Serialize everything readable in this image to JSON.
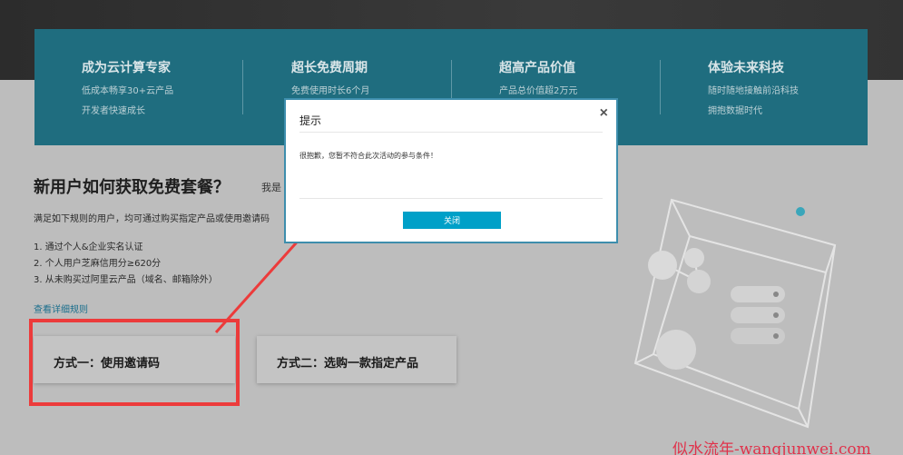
{
  "banner": {
    "features": [
      {
        "title": "成为云计算专家",
        "lines": [
          "低成本畅享30+云产品",
          "开发者快速成长"
        ]
      },
      {
        "title": "超长免费周期",
        "lines": [
          "免费使用时长6个月",
          ""
        ]
      },
      {
        "title": "超高产品价值",
        "lines": [
          "产品总价值超2万元",
          ""
        ]
      },
      {
        "title": "体验未来科技",
        "lines": [
          "随时随地接触前沿科技",
          "拥抱数据时代"
        ]
      }
    ]
  },
  "main": {
    "heading": "新用户如何获取免费套餐？",
    "side_note": "我是",
    "intro": "满足如下规则的用户，均可通过购买指定产品或使用邀请码",
    "rules": [
      "1. 通过个人&企业实名认证",
      "2. 个人用户芝麻信用分≥620分",
      "3. 从未购买过阿里云产品（域名、邮箱除外）"
    ],
    "detail_link": "查看详细规则",
    "methods": [
      "方式一：使用邀请码",
      "方式二：选购一款指定产品"
    ]
  },
  "modal": {
    "title": "提示",
    "close_glyph": "×",
    "message": "很抱歉，您暂不符合此次活动的参与条件！",
    "button_label": "关闭"
  },
  "watermark": "似水流年-wangjunwei.com",
  "colors": {
    "banner_bg": "#1f6d7f",
    "modal_button": "#00a0c8",
    "annotation_red": "#ec3b3b"
  }
}
